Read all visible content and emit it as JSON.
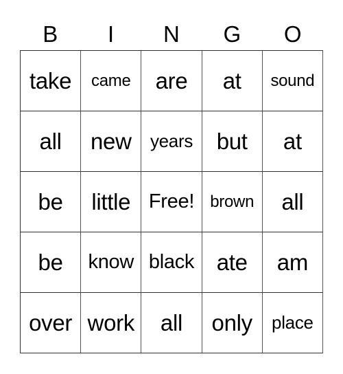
{
  "header": [
    "B",
    "I",
    "N",
    "G",
    "O"
  ],
  "rows": [
    [
      "take",
      "came",
      "are",
      "at",
      "sound"
    ],
    [
      "all",
      "new",
      "years",
      "but",
      "at"
    ],
    [
      "be",
      "little",
      "Free!",
      "brown",
      "all"
    ],
    [
      "be",
      "know",
      "black",
      "ate",
      "am"
    ],
    [
      "over",
      "work",
      "all",
      "only",
      "place"
    ]
  ]
}
